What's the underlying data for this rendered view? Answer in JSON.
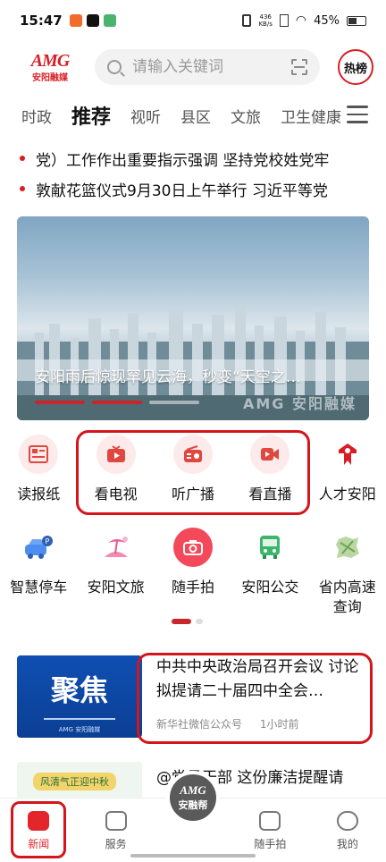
{
  "status_bar": {
    "time": "15:47",
    "speed_value": "436",
    "speed_unit": "KB/s",
    "battery": "45%"
  },
  "header": {
    "logo_mark": "AMG",
    "logo_sub": "安阳融媒",
    "search_placeholder": "请输入关键词",
    "hot_label": "热榜",
    "icons": [
      "search-icon",
      "scan-icon"
    ]
  },
  "tabs": [
    {
      "label": "时政",
      "active": false
    },
    {
      "label": "推荐",
      "active": true
    },
    {
      "label": "视听",
      "active": false
    },
    {
      "label": "县区",
      "active": false
    },
    {
      "label": "文旅",
      "active": false
    },
    {
      "label": "卫生健康",
      "active": false
    }
  ],
  "headlines": [
    "党）工作作出重要指示强调 坚持党校姓党牢",
    "敦献花篮仪式9月30日上午举行 习近平等党"
  ],
  "banner": {
    "caption": "安阳雨后惊现罕见云海，秒变“天空之…",
    "watermark": "AMG 安阳融媒",
    "active_dot": 1,
    "dot_count": 3
  },
  "grid_row1": [
    {
      "label": "读报纸",
      "icon": "newspaper-icon"
    },
    {
      "label": "看电视",
      "icon": "tv-icon"
    },
    {
      "label": "听广播",
      "icon": "radio-icon"
    },
    {
      "label": "看直播",
      "icon": "live-video-icon"
    },
    {
      "label": "人才安阳",
      "icon": "talent-icon"
    }
  ],
  "grid_row2": [
    {
      "label": "智慧停车",
      "icon": "parking-car-icon"
    },
    {
      "label": "安阳文旅",
      "icon": "beach-tour-icon"
    },
    {
      "label": "随手拍",
      "icon": "camera-icon"
    },
    {
      "label": "安阳公交",
      "icon": "bus-icon"
    },
    {
      "label": "省内高速\n查询",
      "icon": "highway-map-icon"
    }
  ],
  "news": [
    {
      "thumb_text": "聚焦",
      "thumb_tag": "AMG 安阳融媒",
      "title": "中共中央政治局召开会议 讨论拟提请二十届四中全会…",
      "source": "新华社微信公众号",
      "time": "1小时前"
    },
    {
      "thumb_text": "风清气正迎中秋",
      "title": "@党员干部 这份廉洁提醒请"
    }
  ],
  "bottom_nav": [
    {
      "label": "新闻",
      "icon": "news-icon",
      "active": true
    },
    {
      "label": "服务",
      "icon": "service-icon",
      "active": false
    },
    {
      "label": "随手拍",
      "icon": "snapshot-icon",
      "active": false
    },
    {
      "label": "我的",
      "icon": "profile-icon",
      "active": false
    }
  ],
  "center_button": {
    "mark": "AMG",
    "label": "安融帮"
  },
  "colors": {
    "brand_red": "#d81e24",
    "highlight_red": "#d4151c"
  }
}
